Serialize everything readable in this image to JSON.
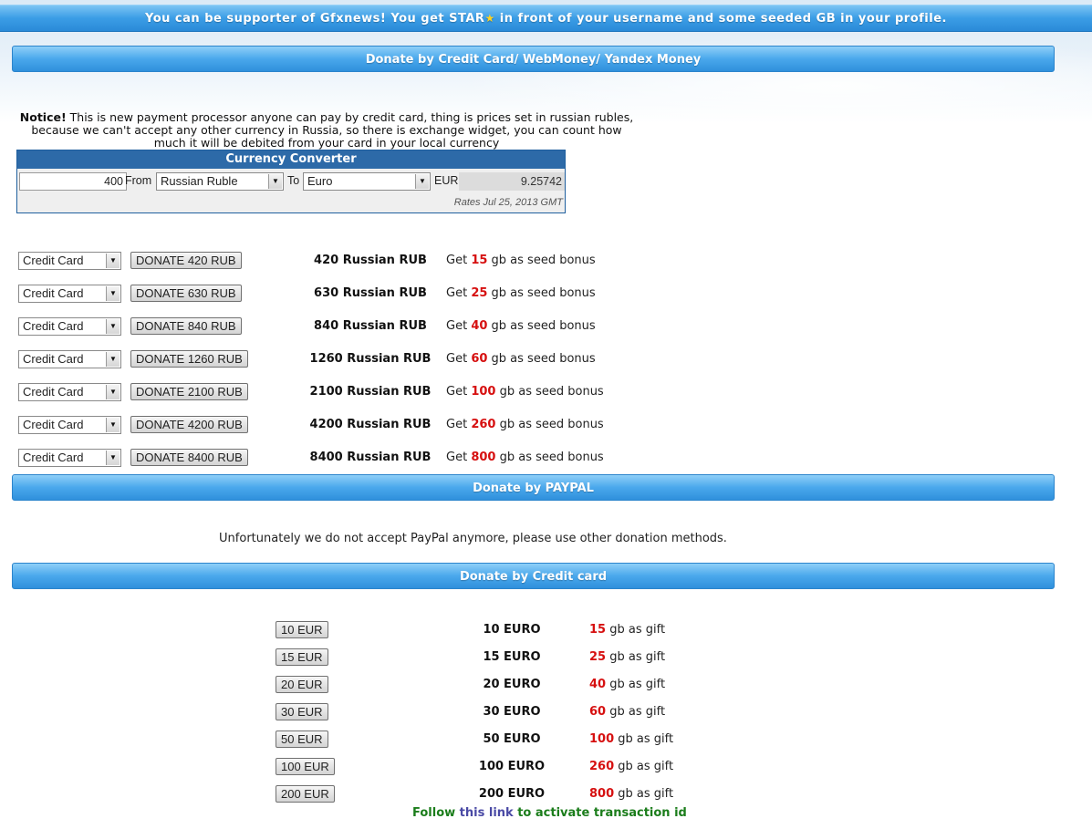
{
  "top_banner": {
    "before_star": "You can be supporter of Gfxnews! You get STAR",
    "after_star": " in front of your username and some seeded GB in your profile."
  },
  "sections": {
    "card_webmoney": "Donate by Credit Card/ WebMoney/ Yandex Money",
    "paypal": "Donate by PAYPAL",
    "credit_card": "Donate by Credit card"
  },
  "notice": {
    "label": "Notice!",
    "text": " This is new payment processor anyone can pay by credit card, thing is prices set in russian rubles, because we can't accept any other currency in Russia, so there is exchange widget, you can count how much it will be debited from your card in your local currency"
  },
  "converter": {
    "title": "Currency Converter",
    "amount": "400",
    "from_label": "From",
    "from_value": "Russian Ruble",
    "to_label": "To",
    "to_value": "Euro",
    "result_currency": "EUR",
    "result_value": "9.25742",
    "rates": "Rates Jul 25, 2013 GMT"
  },
  "rub_rows": [
    {
      "method": "Credit Card",
      "button": "DONATE 420 RUB",
      "amount": "420 Russian RUB",
      "bonus_prefix": "Get ",
      "gb": "15",
      "bonus_suffix": " gb as seed bonus"
    },
    {
      "method": "Credit Card",
      "button": "DONATE 630 RUB",
      "amount": "630 Russian RUB",
      "bonus_prefix": "Get ",
      "gb": "25",
      "bonus_suffix": " gb as seed bonus"
    },
    {
      "method": "Credit Card",
      "button": "DONATE 840 RUB",
      "amount": "840 Russian RUB",
      "bonus_prefix": "Get ",
      "gb": "40",
      "bonus_suffix": " gb as seed bonus"
    },
    {
      "method": "Credit Card",
      "button": "DONATE 1260 RUB",
      "amount": "1260 Russian RUB",
      "bonus_prefix": "Get ",
      "gb": "60",
      "bonus_suffix": " gb as seed bonus"
    },
    {
      "method": "Credit Card",
      "button": "DONATE 2100 RUB",
      "amount": "2100 Russian RUB",
      "bonus_prefix": "Get ",
      "gb": "100",
      "bonus_suffix": " gb as seed bonus"
    },
    {
      "method": "Credit Card",
      "button": "DONATE 4200 RUB",
      "amount": "4200 Russian RUB",
      "bonus_prefix": "Get ",
      "gb": "260",
      "bonus_suffix": " gb as seed bonus"
    },
    {
      "method": "Credit Card",
      "button": "DONATE 8400 RUB",
      "amount": "8400 Russian RUB",
      "bonus_prefix": "Get ",
      "gb": "800",
      "bonus_suffix": " gb as seed bonus"
    }
  ],
  "paypal_message": "Unfortunately we do not accept PayPal anymore, please use other donation methods.",
  "eur_rows": [
    {
      "button": "10 EUR",
      "amount": "10 EURO",
      "gb": "15",
      "suffix": " gb as gift"
    },
    {
      "button": "15 EUR",
      "amount": "15 EURO",
      "gb": "25",
      "suffix": " gb as gift"
    },
    {
      "button": "20 EUR",
      "amount": "20 EURO",
      "gb": "40",
      "suffix": " gb as gift"
    },
    {
      "button": "30 EUR",
      "amount": "30 EURO",
      "gb": "60",
      "suffix": " gb as gift"
    },
    {
      "button": "50 EUR",
      "amount": "50 EURO",
      "gb": "100",
      "suffix": " gb as gift"
    },
    {
      "button": "100 EUR",
      "amount": "100 EURO",
      "gb": "260",
      "suffix": " gb as gift"
    },
    {
      "button": "200 EUR",
      "amount": "200 EURO",
      "gb": "800",
      "suffix": " gb as gift"
    }
  ],
  "follow": {
    "before": "Follow ",
    "link": "this link",
    "after": " to activate transaction id"
  },
  "colors": {
    "bar_blue": "#3b9de6",
    "bonus_red": "#d61010",
    "follow_green": "#1b7d1b",
    "converter_header": "#2d6aa8"
  }
}
